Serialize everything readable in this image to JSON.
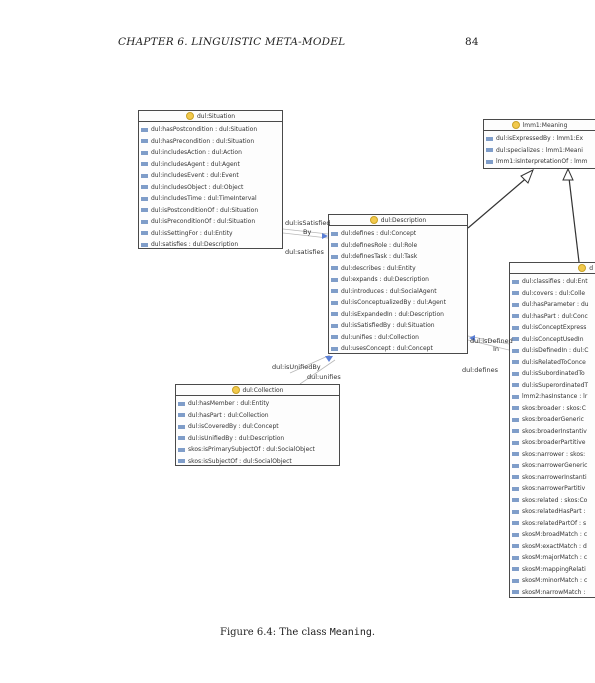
{
  "header": {
    "chapter": "CHAPTER 6.  LINGUISTIC META-MODEL",
    "page_number": "84"
  },
  "classes": {
    "situation": {
      "title": "dul:Situation",
      "attributes": [
        "dul:hasPostcondition : dul:Situation",
        "dul:hasPrecondition : dul:Situation",
        "dul:includesAction : dul:Action",
        "dul:includesAgent : dul:Agent",
        "dul:includesEvent : dul:Event",
        "dul:includesObject : dul:Object",
        "dul:includesTime : dul:TimeInterval",
        "dul:isPostconditionOf : dul:Situation",
        "dul:isPreconditionOf : dul:Situation",
        "dul:isSettingFor : dul:Entity",
        "dul:satisfies : dul:Description"
      ]
    },
    "meaning": {
      "title": "lmm1:Meaning",
      "attributes": [
        "dul:isExpressedBy : lmm1:Ex",
        "dul:specializes : lmm1:Meani",
        "lmm1:isInterpretationOf : lmm"
      ]
    },
    "description": {
      "title": "dul:Description",
      "attributes": [
        "dul:defines : dul:Concept",
        "dul:definesRole : dul:Role",
        "dul:definesTask : dul:Task",
        "dul:describes : dul:Entity",
        "dul:expands : dul:Description",
        "dul:introduces : dul:SocialAgent",
        "dul:isConceptualizedBy : dul:Agent",
        "dul:isExpandedIn : dul:Description",
        "dul:isSatisfiedBy : dul:Situation",
        "dul:unifies : dul:Collection",
        "dul:usesConcept : dul:Concept"
      ]
    },
    "collection": {
      "title": "dul:Collection",
      "attributes": [
        "dul:hasMember : dul:Entity",
        "dul:hasPart : dul:Collection",
        "dul:isCoveredBy : dul:Concept",
        "dul:isUnifiedBy : dul:Description",
        "skos:isPrimarySubjectOf : dul:SocialObject",
        "skos:isSubjectOf : dul:SocialObject"
      ]
    },
    "concept": {
      "title": "d",
      "attributes": [
        "dul:classifies : dul:Ent",
        "dul:covers : dul:Colle",
        "dul:hasParameter : du",
        "dul:hasPart : dul:Conc",
        "dul:isConceptExpress",
        "dul:isConceptUsedIn",
        "dul:isDefinedIn : dul:C",
        "dul:isRelatedToConce",
        "dul:isSubordinatedTo",
        "dul:isSuperordinatedT",
        "lmm2:hasInstance : lr",
        "skos:broader : skos:C",
        "skos:broaderGeneric",
        "skos:broaderInstantiv",
        "skos:broaderPartitive",
        "skos:narrower : skos:",
        "skos:narrowerGeneric",
        "skos:narrowerInstanti",
        "skos:narrowerPartitiv",
        "skos:related : skos:Co",
        "skos:relatedHasPart :",
        "skos:relatedPartOf : s",
        "skosM:broadMatch : c",
        "skosM:exactMatch : d",
        "skosM:majorMatch : c",
        "skosM:mappingRelati",
        "skosM:minorMatch : c",
        "skosM:narrowMatch :"
      ]
    }
  },
  "edge_labels": {
    "is_satisfied_by_1": "dul:isSatisfied",
    "is_satisfied_by_2": "By",
    "satisfies": "dul:satisfies",
    "is_unified_by": "dul:isUnifiedBy",
    "unifies": "dul:unifies",
    "is_defined_in_1": "dul:isDefined",
    "is_defined_in_2": "In",
    "defines": "dul:defines"
  },
  "caption": {
    "prefix": "Figure 6.4:  The class ",
    "class_name": "Meaning",
    "suffix": "."
  },
  "colors": {
    "header_dot": "#f2c94c",
    "attribute_marker": "#7f9dc9",
    "arrow_tip": "#5b7fd6"
  }
}
